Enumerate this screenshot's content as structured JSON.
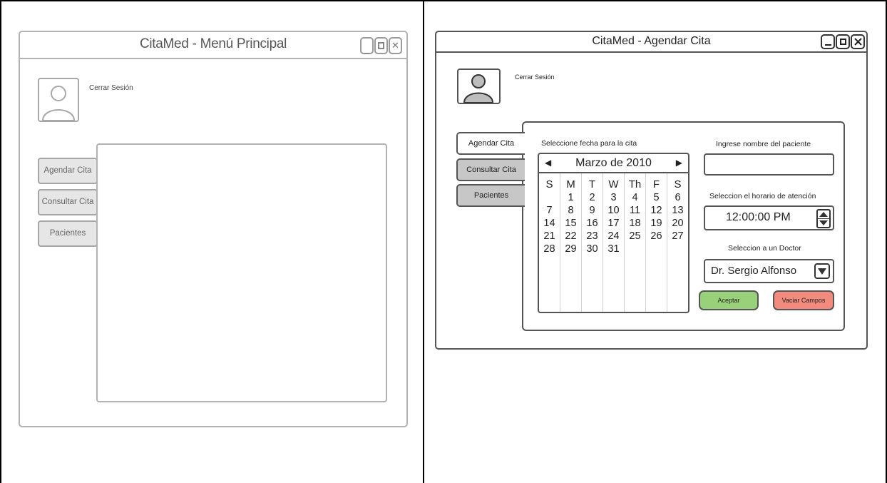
{
  "left_window": {
    "title": "CitaMed - Menú Principal",
    "logout": "Cerrar Sesión",
    "nav": [
      {
        "label": "Agendar Cita"
      },
      {
        "label": "Consultar Cita"
      },
      {
        "label": "Pacientes"
      }
    ]
  },
  "right_window": {
    "title": "CitaMed - Agendar Cita",
    "logout": "Cerrar Sesión",
    "tabs": [
      {
        "label": "Agendar Cita",
        "active": true
      },
      {
        "label": "Consultar Cita",
        "active": false
      },
      {
        "label": "Pacientes",
        "active": false
      }
    ],
    "date_label": "Seleccione fecha para la cita",
    "calendar": {
      "month": "Marzo de 2010",
      "columns": [
        {
          "dow": "S",
          "days": [
            "",
            "7",
            "14",
            "21",
            "28"
          ]
        },
        {
          "dow": "M",
          "days": [
            "1",
            "8",
            "15",
            "22",
            "29"
          ]
        },
        {
          "dow": "T",
          "days": [
            "2",
            "9",
            "16",
            "23",
            "30"
          ]
        },
        {
          "dow": "W",
          "days": [
            "3",
            "10",
            "17",
            "24",
            "31"
          ]
        },
        {
          "dow": "Th",
          "days": [
            "4",
            "11",
            "18",
            "25",
            ""
          ]
        },
        {
          "dow": "F",
          "days": [
            "5",
            "12",
            "19",
            "26",
            ""
          ]
        },
        {
          "dow": "S",
          "days": [
            "6",
            "13",
            "20",
            "27",
            ""
          ]
        }
      ]
    },
    "patient_label": "Ingrese nombre del paciente",
    "patient_value": "",
    "time_label": "Seleccion el horario de atención",
    "time_value": "12:00:00 PM",
    "doctor_label": "Seleccion a un Doctor",
    "doctor_value": "Dr. Sergio Alfonso",
    "accept_label": "Aceptar",
    "clear_label": "Vaciar Campos",
    "colors": {
      "accept": "#99d17b",
      "clear": "#f28b7d",
      "inactive_tab": "#c7c7c7"
    }
  }
}
